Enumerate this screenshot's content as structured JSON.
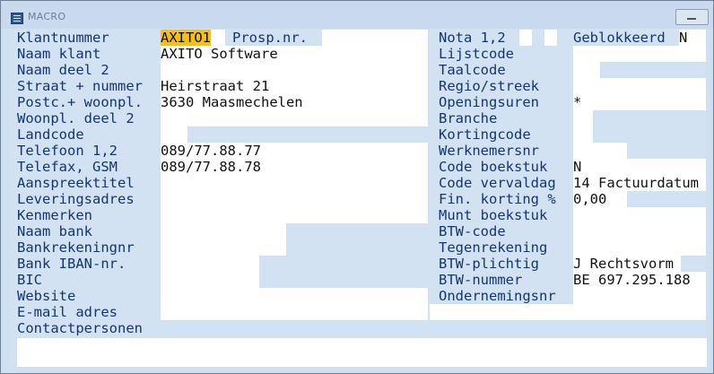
{
  "window": {
    "title": "MACRO"
  },
  "left_labels": [
    "Klantnummer",
    "Naam klant",
    "Naam deel 2",
    "Straat + nummer",
    "Postc.+ woonpl.",
    "Woonpl. deel 2",
    "Landcode",
    "Telefoon 1,2",
    "Telefax, GSM",
    "Aanspreektitel",
    "Leveringsadres",
    "Kenmerken",
    "Naam bank",
    "Bankrekeningnr",
    "Bank IBAN-nr.",
    "BIC",
    "Website",
    "E-mail adres",
    "Contactpersonen"
  ],
  "left_values": {
    "klantnummer": "AXITO1",
    "prosp_label": "Prosp.nr.",
    "naam_klant": "AXITO Software",
    "straat": "Heirstraat 21",
    "postcode_woonplaats": "3630 Maasmechelen",
    "telefoon": "089/77.88.77",
    "telefax": "089/77.88.78"
  },
  "right_labels": [
    "Nota 1,2",
    "Lijstcode",
    "Taalcode",
    "Regio/streek",
    "Openingsuren",
    "Branche",
    "Kortingcode",
    "Werknemersnr",
    "Code boekstuk",
    "Code vervaldag",
    "Fin. korting %",
    "Munt boekstuk",
    "BTW-code",
    "Tegenrekening",
    "BTW-plichtig",
    "BTW-nummer",
    "Ondernemingsnr"
  ],
  "right_values": {
    "geblokkeerd_label": "Geblokkeerd",
    "geblokkeerd": "N",
    "openingsuren": "*",
    "code_boekstuk": "N",
    "code_vervaldag": "14 Factuurdatum",
    "fin_korting": "0,00",
    "btw_plichtig": "J Rechtsvorm",
    "btw_nummer": "BE 697.295.188"
  }
}
